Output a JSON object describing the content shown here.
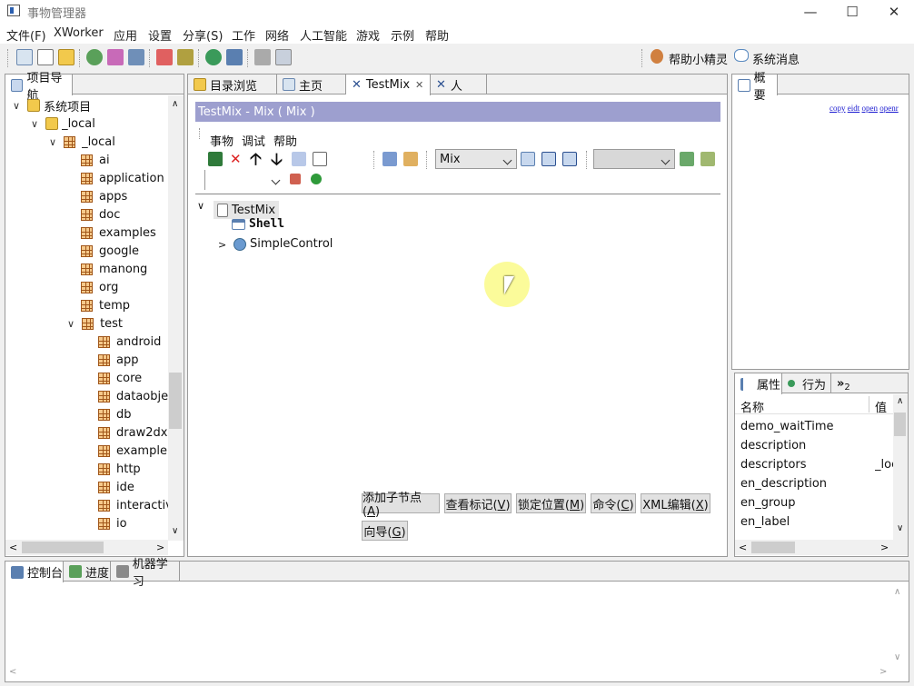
{
  "window": {
    "title": "事物管理器"
  },
  "menu": [
    "文件(F)",
    "XWorker",
    "应用",
    "设置",
    "分享(S)",
    "工作",
    "网络",
    "人工智能",
    "游戏",
    "示例",
    "帮助"
  ],
  "toolbar_right": {
    "helper": "帮助小精灵",
    "messages": "系统消息"
  },
  "nav": {
    "tab": "项目导航",
    "root": "系统项目",
    "local1": "_local",
    "local2": "_local",
    "pkgs": [
      "ai",
      "application",
      "apps",
      "doc",
      "examples",
      "google",
      "manong",
      "org",
      "temp",
      "test"
    ],
    "test_children": [
      "android",
      "app",
      "core",
      "dataobjec",
      "db",
      "draw2dx",
      "example",
      "http",
      "ide",
      "interactive",
      "io"
    ]
  },
  "center": {
    "tabs": [
      "目录浏览",
      "主页",
      "TestMix",
      "人"
    ],
    "header": "TestMix - Mix ( Mix )",
    "submenu": [
      "事物",
      "调试",
      "帮助"
    ],
    "combo_value": "Mix",
    "tree": {
      "root": "TestMix",
      "child1": "Shell",
      "child2": "SimpleControl"
    },
    "buttons": [
      "添加子节点(A)",
      "查看标记(V)",
      "锁定位置(M)",
      "命令(C)",
      "XML编辑(X)",
      "向导(G)"
    ],
    "mnemonics": [
      "A",
      "V",
      "M",
      "C",
      "X",
      "G"
    ]
  },
  "overview": {
    "tab": "概要",
    "links": [
      "copy",
      "eidt",
      "open",
      "openr"
    ]
  },
  "props": {
    "tabs": [
      "属性",
      "行为",
      "2"
    ],
    "col_name": "名称",
    "col_value": "值",
    "rows": [
      {
        "name": "demo_waitTime",
        "value": ""
      },
      {
        "name": "description",
        "value": ""
      },
      {
        "name": "descriptors",
        "value": "_loc"
      },
      {
        "name": "en_description",
        "value": ""
      },
      {
        "name": "en_group",
        "value": ""
      },
      {
        "name": "en_label",
        "value": ""
      }
    ]
  },
  "bottom": {
    "tabs": [
      "控制台",
      "进度",
      "机器学习"
    ]
  }
}
